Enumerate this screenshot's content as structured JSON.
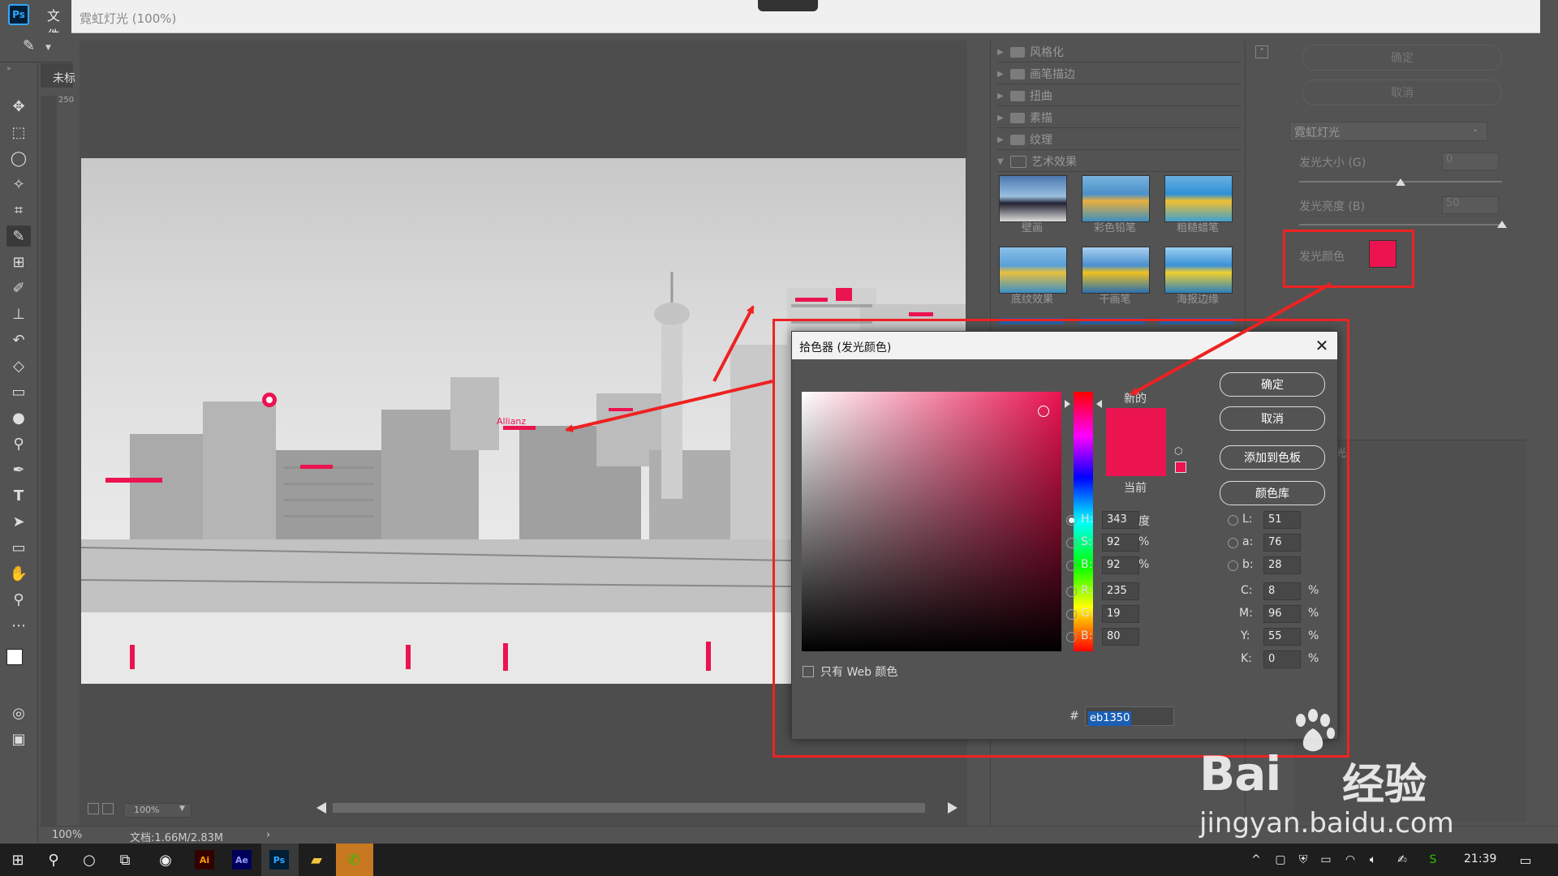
{
  "app": {
    "logo": "Ps",
    "menu_file": "文件",
    "gallery_title": "霓虹灯光 (100%)",
    "doc_tab": "未标",
    "ruler_top": "250"
  },
  "filter_gallery": {
    "categories": [
      {
        "label": "风格化",
        "expanded": false
      },
      {
        "label": "画笔描边",
        "expanded": false
      },
      {
        "label": "扭曲",
        "expanded": false
      },
      {
        "label": "素描",
        "expanded": false
      },
      {
        "label": "纹理",
        "expanded": false
      },
      {
        "label": "艺术效果",
        "expanded": true
      }
    ],
    "thumbnails": [
      "壁画",
      "彩色铅笔",
      "粗糙蜡笔",
      "底纹效果",
      "干画笔",
      "海报边缘"
    ],
    "preview_sign": "Allianz"
  },
  "settings": {
    "ok_label": "确定",
    "cancel_label": "取消",
    "filter_select": "霓虹灯光",
    "glow_size_label": "发光大小 (G)",
    "glow_size_value": "0",
    "glow_brightness_label": "发光亮度 (B)",
    "glow_brightness_value": "50",
    "glow_color_label": "发光颜色",
    "glow_color": "#eb1350",
    "partial_label": "光",
    "glow_size_fraction": 0.5,
    "glow_brightness_fraction": 1.0
  },
  "preview": {
    "zoom": "100%"
  },
  "status": {
    "zoom": "100%",
    "doc_info": "文档:1.66M/2.83M"
  },
  "color_picker": {
    "title": "拾色器 (发光颜色)",
    "close_symbol": "✕",
    "new_label": "新的",
    "current_label": "当前",
    "new_color": "#eb1350",
    "current_color": "#eb1350",
    "buttons": {
      "ok": "确定",
      "cancel": "取消",
      "add_to_swatches": "添加到色板",
      "color_libraries": "颜色库"
    },
    "web_only_label": "只有 Web 颜色",
    "fields": {
      "H": {
        "label": "H:",
        "value": "343",
        "unit": "度"
      },
      "S": {
        "label": "S:",
        "value": "92",
        "unit": "%"
      },
      "Bv": {
        "label": "B:",
        "value": "92",
        "unit": "%"
      },
      "R": {
        "label": "R:",
        "value": "235"
      },
      "G": {
        "label": "G:",
        "value": "19"
      },
      "Bc": {
        "label": "B:",
        "value": "80"
      },
      "L": {
        "label": "L:",
        "value": "51"
      },
      "a": {
        "label": "a:",
        "value": "76"
      },
      "b": {
        "label": "b:",
        "value": "28"
      },
      "C": {
        "label": "C:",
        "value": "8",
        "unit": "%"
      },
      "M": {
        "label": "M:",
        "value": "96",
        "unit": "%"
      },
      "Y": {
        "label": "Y:",
        "value": "55",
        "unit": "%"
      },
      "K": {
        "label": "K:",
        "value": "0",
        "unit": "%"
      }
    },
    "hash": "#",
    "hex": "eb1350"
  },
  "taskbar": {
    "time": "21:39"
  },
  "watermark": {
    "brand": "Bai",
    "brand_cn": "经验",
    "url": "jingyan.baidu.com"
  },
  "colors": {
    "annotation": "#ee2222",
    "accent": "#eb1350",
    "ui_bg": "#535353"
  }
}
